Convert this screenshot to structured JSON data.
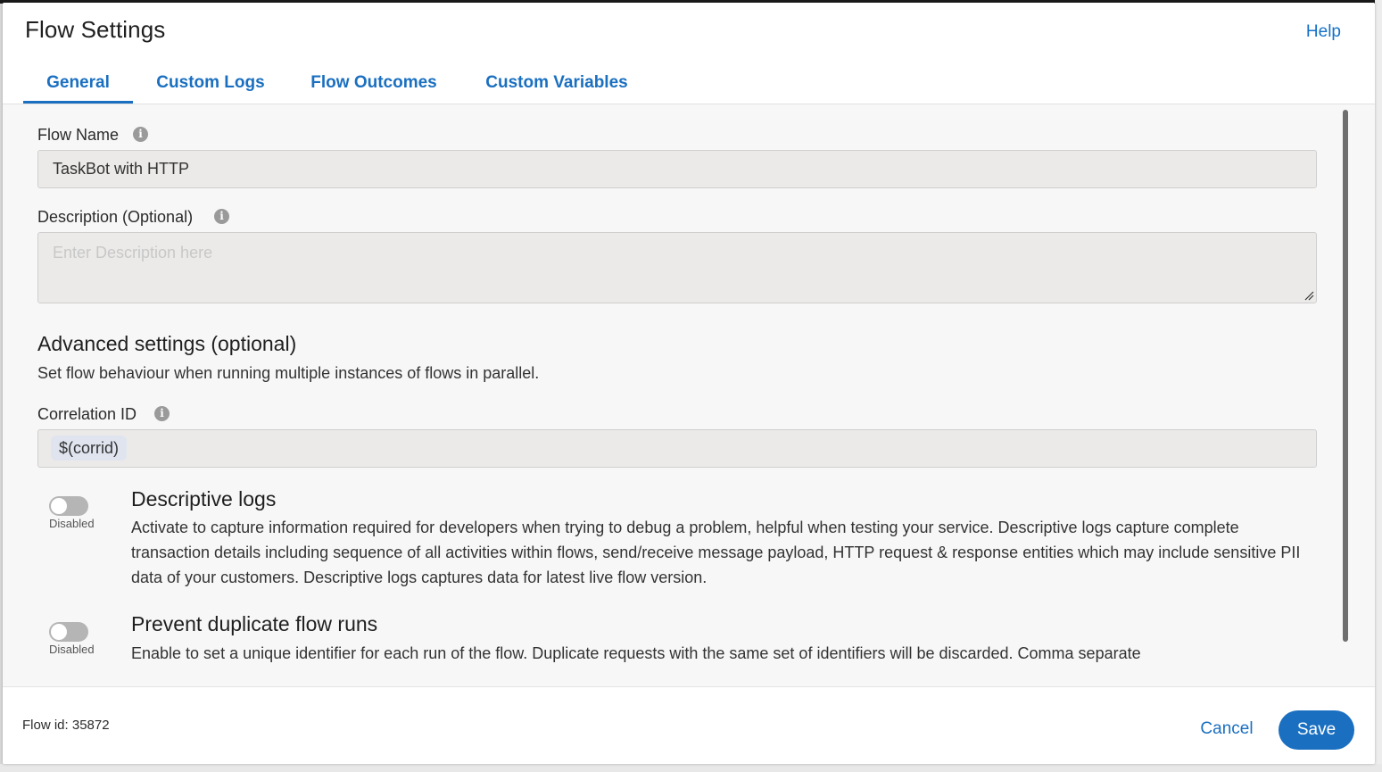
{
  "header": {
    "title": "Flow Settings",
    "help_label": "Help"
  },
  "tabs": [
    {
      "label": "General",
      "active": true
    },
    {
      "label": "Custom Logs",
      "active": false
    },
    {
      "label": "Flow Outcomes",
      "active": false
    },
    {
      "label": "Custom Variables",
      "active": false
    }
  ],
  "form": {
    "flow_name": {
      "label": "Flow Name",
      "value": "TaskBot with HTTP"
    },
    "description": {
      "label": "Description (Optional)",
      "value": "",
      "placeholder": "Enter Description here"
    },
    "advanced": {
      "title": "Advanced settings (optional)",
      "subtitle": "Set flow behaviour when running multiple instances of flows in parallel."
    },
    "correlation_id": {
      "label": "Correlation ID",
      "chip": "$(corrid)"
    },
    "descriptive_logs": {
      "title": "Descriptive logs",
      "toggle_state": "Disabled",
      "enabled": false,
      "description": "Activate to capture information required for developers when trying to debug a problem, helpful when testing your service. Descriptive logs capture complete transaction details including sequence of all activities within flows, send/receive message payload, HTTP request & response entities which may include sensitive PII data of your customers. Descriptive logs captures data for latest live flow version."
    },
    "prevent_duplicates": {
      "title": "Prevent duplicate flow runs",
      "toggle_state": "Disabled",
      "enabled": false,
      "description": "Enable to set a unique identifier for each run of the flow. Duplicate requests with the same set of identifiers will be discarded. Comma separate"
    }
  },
  "footer": {
    "flow_id": "Flow id: 35872",
    "cancel_label": "Cancel",
    "save_label": "Save"
  },
  "colors": {
    "accent": "#1a6fc0",
    "input_bg": "#ebeae8",
    "toggle_off": "#b5b5b5"
  },
  "icons": {
    "info": "info-icon",
    "resize": "resize-grip-icon"
  }
}
